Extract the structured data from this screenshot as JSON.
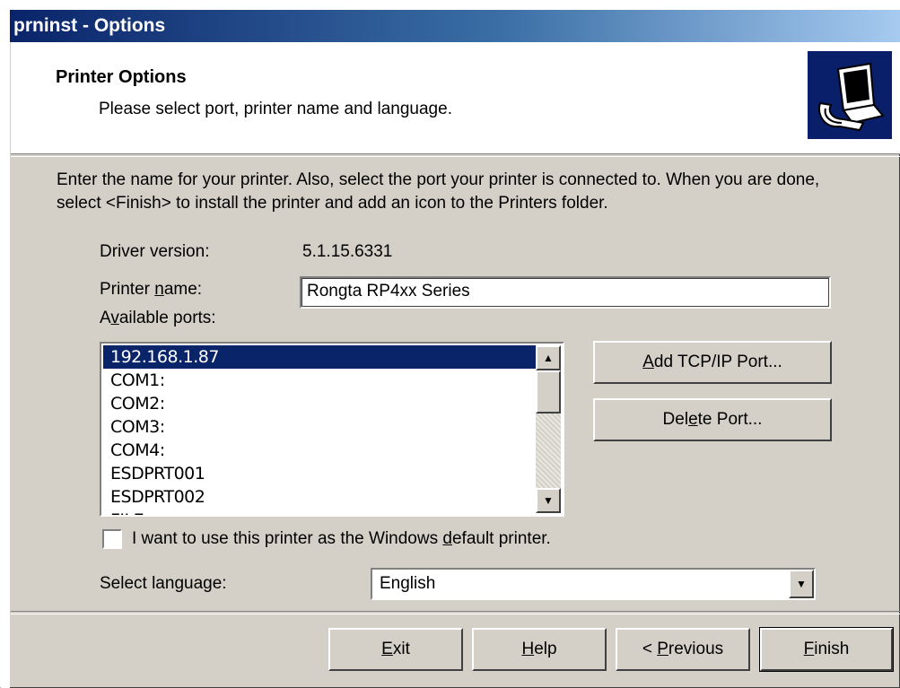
{
  "window": {
    "title": "prninst - Options"
  },
  "header": {
    "title": "Printer Options",
    "subtitle": "Please select port, printer name and language.",
    "icon": "printer-wizard-icon"
  },
  "intro_text": "Enter the name for your printer. Also, select the port your printer is connected to. When you are done, select <Finish> to install the printer and add an icon to the Printers folder.",
  "driver_version": {
    "label": "Driver version:",
    "value": "5.1.15.6331"
  },
  "printer_name": {
    "label_pre": "Printer ",
    "label_accel": "n",
    "label_post": "ame:",
    "value": "Rongta RP4xx Series"
  },
  "available_ports": {
    "label_pre": "A",
    "label_accel": "v",
    "label_post": "ailable ports:",
    "items": [
      {
        "label": "192.168.1.87",
        "selected": true
      },
      {
        "label": "COM1:",
        "selected": false
      },
      {
        "label": "COM2:",
        "selected": false
      },
      {
        "label": "COM3:",
        "selected": false
      },
      {
        "label": "COM4:",
        "selected": false
      },
      {
        "label": "ESDPRT001",
        "selected": false
      },
      {
        "label": "ESDPRT002",
        "selected": false
      },
      {
        "label": "FILE:",
        "selected": false
      }
    ]
  },
  "port_buttons": {
    "add_pre": "",
    "add_accel": "A",
    "add_post": "dd TCP/IP Port...",
    "delete_pre": "Del",
    "delete_accel": "e",
    "delete_post": "te Port..."
  },
  "default_printer": {
    "checked": false,
    "label_pre": "I want to use this printer as the Windows ",
    "label_accel": "d",
    "label_post": "efault printer."
  },
  "language": {
    "label": "Select language:",
    "value": "English"
  },
  "footer": {
    "exit_accel": "E",
    "exit_post": "xit",
    "help_accel": "H",
    "help_post": "elp",
    "previous_pre": "< ",
    "previous_accel": "P",
    "previous_post": "revious",
    "finish_accel": "F",
    "finish_post": "inish"
  }
}
